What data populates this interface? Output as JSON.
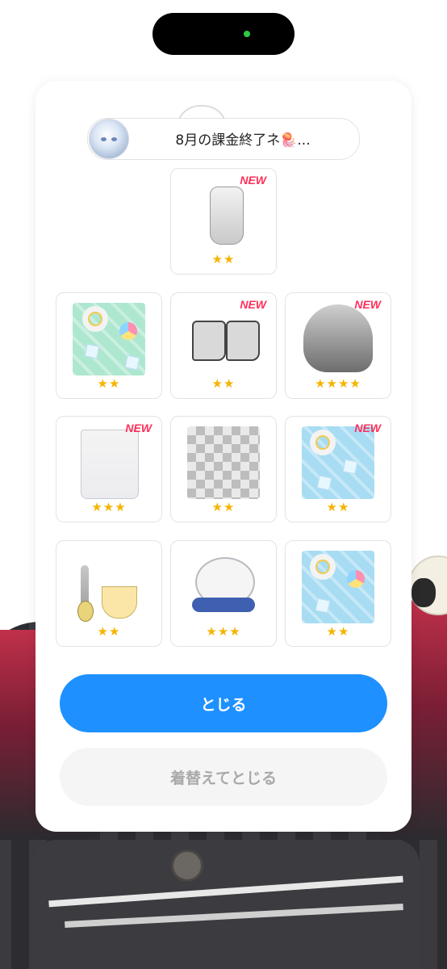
{
  "header": {
    "title": "8月の課金終了ネ",
    "title_suffix_icon": "jellyfish-emoji",
    "ellipsis": "..."
  },
  "items": [
    {
      "name": "glove",
      "stars": "★★",
      "new": "NEW"
    },
    {
      "name": "swim-ring-background-mint",
      "stars": "★★",
      "new": ""
    },
    {
      "name": "sandals",
      "stars": "★★",
      "new": "NEW"
    },
    {
      "name": "silver-hair",
      "stars": "★★★★",
      "new": "NEW"
    },
    {
      "name": "white-skirt",
      "stars": "★★★",
      "new": "NEW"
    },
    {
      "name": "checker-background",
      "stars": "★★",
      "new": ""
    },
    {
      "name": "swim-ring-background-sky",
      "stars": "★★",
      "new": "NEW"
    },
    {
      "name": "shaved-ice-accessory",
      "stars": "★★",
      "new": ""
    },
    {
      "name": "seal-plush",
      "stars": "★★★",
      "new": ""
    },
    {
      "name": "swim-ring-background-sky-2",
      "stars": "★★",
      "new": ""
    }
  ],
  "buttons": {
    "close": "とじる",
    "change_and_close": "着替えてとじる"
  },
  "colors": {
    "primary": "#1e90ff",
    "new_badge": "#ff2f5a",
    "star": "#f5b400"
  }
}
